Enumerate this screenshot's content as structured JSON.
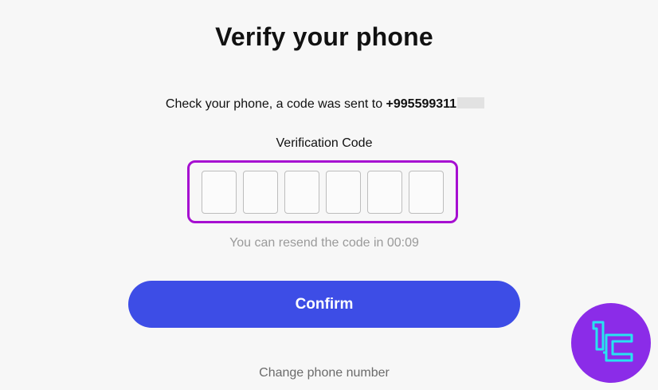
{
  "header": {
    "title": "Verify your phone"
  },
  "message": {
    "prefix": "Check your phone, a code was sent to ",
    "phone": "+995599311"
  },
  "otp": {
    "label": "Verification Code",
    "digits": [
      "",
      "",
      "",
      "",
      "",
      ""
    ]
  },
  "resend": {
    "text": "You can resend the code in 00:09"
  },
  "actions": {
    "confirm_label": "Confirm",
    "change_phone_label": "Change phone number"
  },
  "colors": {
    "accent": "#3d4de6",
    "highlight": "#a60fd1",
    "logo_bg": "#8b2ce8",
    "logo_fg": "#27e3f0"
  },
  "icons": {
    "logo": "tradingfinder-logo-icon"
  }
}
